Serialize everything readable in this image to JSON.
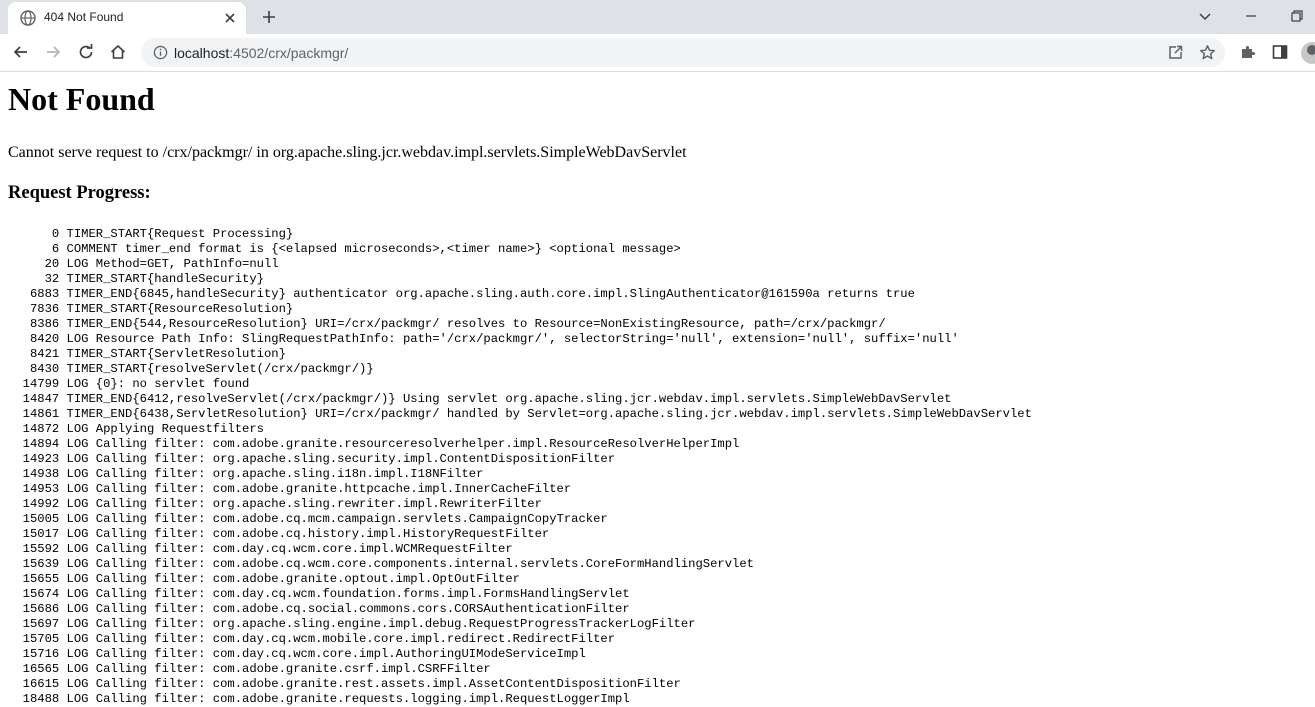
{
  "browser": {
    "tab": {
      "title": "404 Not Found"
    },
    "address_bar": {
      "host": "localhost",
      "path": ":4502/crx/packmgr/"
    }
  },
  "page": {
    "heading": "Not Found",
    "message": "Cannot serve request to /crx/packmgr/ in org.apache.sling.jcr.webdav.impl.servlets.SimpleWebDavServlet",
    "progress_heading": "Request Progress:",
    "log": [
      "      0 TIMER_START{Request Processing}",
      "      6 COMMENT timer_end format is {<elapsed microseconds>,<timer name>} <optional message>",
      "     20 LOG Method=GET, PathInfo=null",
      "     32 TIMER_START{handleSecurity}",
      "   6883 TIMER_END{6845,handleSecurity} authenticator org.apache.sling.auth.core.impl.SlingAuthenticator@161590a returns true",
      "   7836 TIMER_START{ResourceResolution}",
      "   8386 TIMER_END{544,ResourceResolution} URI=/crx/packmgr/ resolves to Resource=NonExistingResource, path=/crx/packmgr/",
      "   8420 LOG Resource Path Info: SlingRequestPathInfo: path='/crx/packmgr/', selectorString='null', extension='null', suffix='null'",
      "   8421 TIMER_START{ServletResolution}",
      "   8430 TIMER_START{resolveServlet(/crx/packmgr/)}",
      "  14799 LOG {0}: no servlet found",
      "  14847 TIMER_END{6412,resolveServlet(/crx/packmgr/)} Using servlet org.apache.sling.jcr.webdav.impl.servlets.SimpleWebDavServlet",
      "  14861 TIMER_END{6438,ServletResolution} URI=/crx/packmgr/ handled by Servlet=org.apache.sling.jcr.webdav.impl.servlets.SimpleWebDavServlet",
      "  14872 LOG Applying Requestfilters",
      "  14894 LOG Calling filter: com.adobe.granite.resourceresolverhelper.impl.ResourceResolverHelperImpl",
      "  14923 LOG Calling filter: org.apache.sling.security.impl.ContentDispositionFilter",
      "  14938 LOG Calling filter: org.apache.sling.i18n.impl.I18NFilter",
      "  14953 LOG Calling filter: com.adobe.granite.httpcache.impl.InnerCacheFilter",
      "  14992 LOG Calling filter: org.apache.sling.rewriter.impl.RewriterFilter",
      "  15005 LOG Calling filter: com.adobe.cq.mcm.campaign.servlets.CampaignCopyTracker",
      "  15017 LOG Calling filter: com.adobe.cq.history.impl.HistoryRequestFilter",
      "  15592 LOG Calling filter: com.day.cq.wcm.core.impl.WCMRequestFilter",
      "  15639 LOG Calling filter: com.adobe.cq.wcm.core.components.internal.servlets.CoreFormHandlingServlet",
      "  15655 LOG Calling filter: com.adobe.granite.optout.impl.OptOutFilter",
      "  15674 LOG Calling filter: com.day.cq.wcm.foundation.forms.impl.FormsHandlingServlet",
      "  15686 LOG Calling filter: com.adobe.cq.social.commons.cors.CORSAuthenticationFilter",
      "  15697 LOG Calling filter: org.apache.sling.engine.impl.debug.RequestProgressTrackerLogFilter",
      "  15705 LOG Calling filter: com.day.cq.wcm.mobile.core.impl.redirect.RedirectFilter",
      "  15716 LOG Calling filter: com.day.cq.wcm.core.impl.AuthoringUIModeServiceImpl",
      "  16565 LOG Calling filter: com.adobe.granite.csrf.impl.CSRFFilter",
      "  16615 LOG Calling filter: com.adobe.granite.rest.assets.impl.AssetContentDispositionFilter",
      "  18488 LOG Calling filter: com.adobe.granite.requests.logging.impl.RequestLoggerImpl"
    ]
  },
  "icons": {
    "tab_favicon": "globe-icon",
    "tab_close": "close-icon",
    "new_tab": "plus-icon",
    "tab_search": "chevron-down-icon",
    "minimize": "minimize-icon",
    "restore": "restore-icon",
    "back": "back-arrow-icon",
    "forward": "forward-arrow-icon",
    "reload": "reload-icon",
    "home": "home-icon",
    "site_info": "info-icon",
    "share": "share-icon",
    "bookmark": "star-icon",
    "extensions": "puzzle-icon",
    "side_panel": "side-panel-icon",
    "profile": "avatar-icon"
  }
}
